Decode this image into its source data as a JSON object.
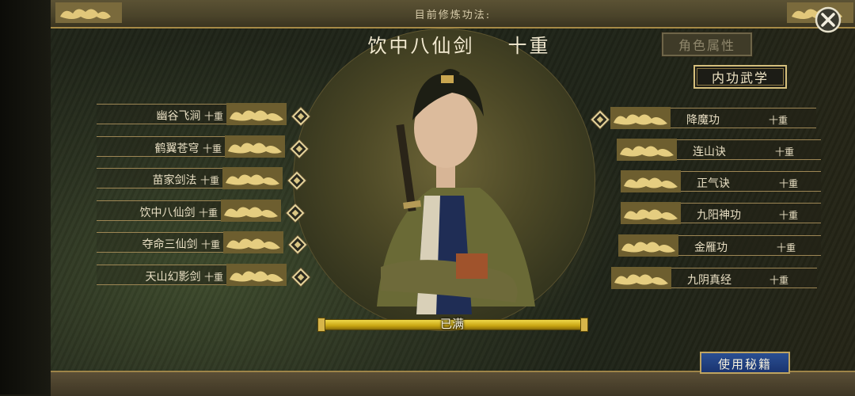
{
  "header": {
    "cultivation_label": "目前修炼功法:"
  },
  "current": {
    "name": "饮中八仙剑",
    "level": "十重"
  },
  "buttons": {
    "attributes": "角色属性",
    "neigong": "内功武学",
    "use_manual": "使用秘籍"
  },
  "left_skills": [
    {
      "name": "幽谷飞涧",
      "level": "十重"
    },
    {
      "name": "鹤翼苍穹",
      "level": "十重"
    },
    {
      "name": "苗家剑法",
      "level": "十重"
    },
    {
      "name": "饮中八仙剑",
      "level": "十重"
    },
    {
      "name": "夺命三仙剑",
      "level": "十重"
    },
    {
      "name": "天山幻影剑",
      "level": "十重"
    }
  ],
  "right_skills": [
    {
      "name": "降魔功",
      "level": "十重"
    },
    {
      "name": "连山诀",
      "level": "十重"
    },
    {
      "name": "正气诀",
      "level": "十重"
    },
    {
      "name": "九阳神功",
      "level": "十重"
    },
    {
      "name": "金雁功",
      "level": "十重"
    },
    {
      "name": "九阴真经",
      "level": "十重"
    }
  ],
  "progress": {
    "label": "已满",
    "fraction": 1.0
  },
  "icons": {
    "close": "close-icon",
    "badge": "cloud-badge-icon",
    "selector": "diamond-selector-icon"
  },
  "colors": {
    "gold": "#d5bf7c",
    "use_button": "#2a4f93",
    "progress": "#e6c622"
  }
}
